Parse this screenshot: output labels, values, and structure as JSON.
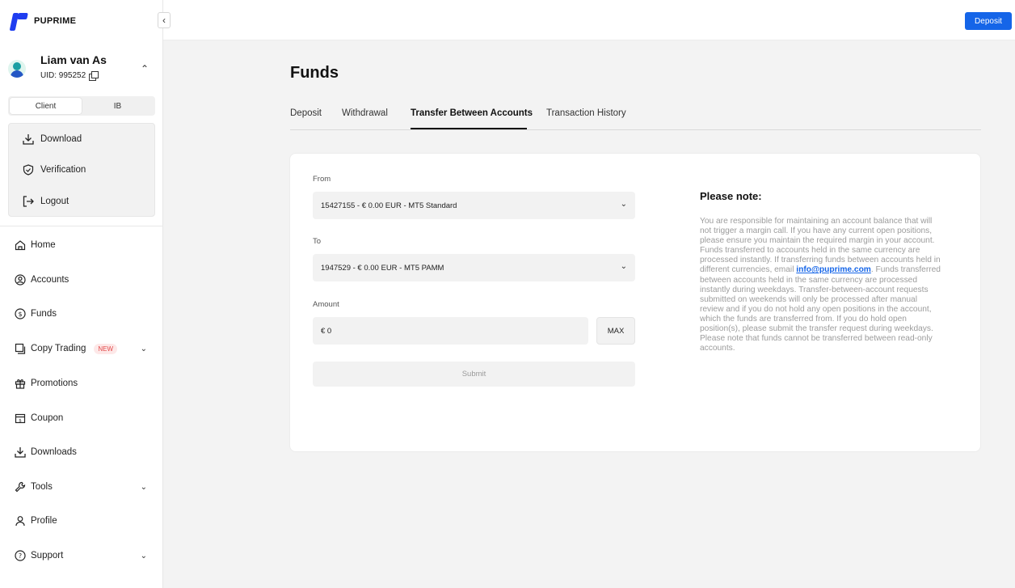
{
  "brand": {
    "name": "PUPRIME",
    "accent": "#1f3df0",
    "button_blue": "#1565e8"
  },
  "header": {
    "deposit_label": "Deposit"
  },
  "user": {
    "name": "Liam van As",
    "uid": "UID: 995252"
  },
  "roles": {
    "client": "Client",
    "ib": "IB",
    "selected": "Client"
  },
  "quick_menu": [
    {
      "label": "Download",
      "icon": "download-icon"
    },
    {
      "label": "Verification",
      "icon": "shield-check-icon"
    },
    {
      "label": "Logout",
      "icon": "logout-icon"
    }
  ],
  "nav": [
    {
      "label": "Home",
      "icon": "home-icon"
    },
    {
      "label": "Accounts",
      "icon": "accounts-icon"
    },
    {
      "label": "Funds",
      "icon": "funds-icon"
    },
    {
      "label": "Copy Trading",
      "icon": "copy-trading-icon",
      "badge": "NEW",
      "expandable": true
    },
    {
      "label": "Promotions",
      "icon": "gift-icon"
    },
    {
      "label": "Coupon",
      "icon": "coupon-icon"
    },
    {
      "label": "Downloads",
      "icon": "download-icon"
    },
    {
      "label": "Tools",
      "icon": "wrench-icon",
      "expandable": true
    },
    {
      "label": "Profile",
      "icon": "profile-icon"
    },
    {
      "label": "Support",
      "icon": "support-icon",
      "expandable": true
    }
  ],
  "page": {
    "title": "Funds",
    "tabs": [
      "Deposit",
      "Withdrawal",
      "Transfer Between Accounts",
      "Transaction History"
    ],
    "active_tab": "Transfer Between Accounts"
  },
  "form": {
    "from_label": "From",
    "from_value": "15427155 - € 0.00 EUR - MT5 Standard",
    "to_label": "To",
    "to_value": "1947529 - € 0.00 EUR - MT5 PAMM",
    "amount_label": "Amount",
    "amount_value": "€ 0",
    "max_label": "MAX",
    "submit_label": "Submit"
  },
  "note": {
    "title": "Please note:",
    "text_part1": "You are responsible for maintaining an account balance that will not trigger a margin call. If you have any current open positions, please ensure you maintain the required margin in your account. Funds transferred to accounts held in the same currency are processed instantly. If transferring funds between accounts held in different currencies, email ",
    "email": "info@puprime.com",
    "text_part2": ". Funds transferred between accounts held in the same currency are processed instantly during weekdays. Transfer-between-account requests submitted on weekends will only be processed after manual review and if you do not hold any open positions in the account, which the funds are transferred from. If you do hold open position(s), please submit the transfer request during weekdays. Please note that funds cannot be transferred between read-only accounts."
  }
}
